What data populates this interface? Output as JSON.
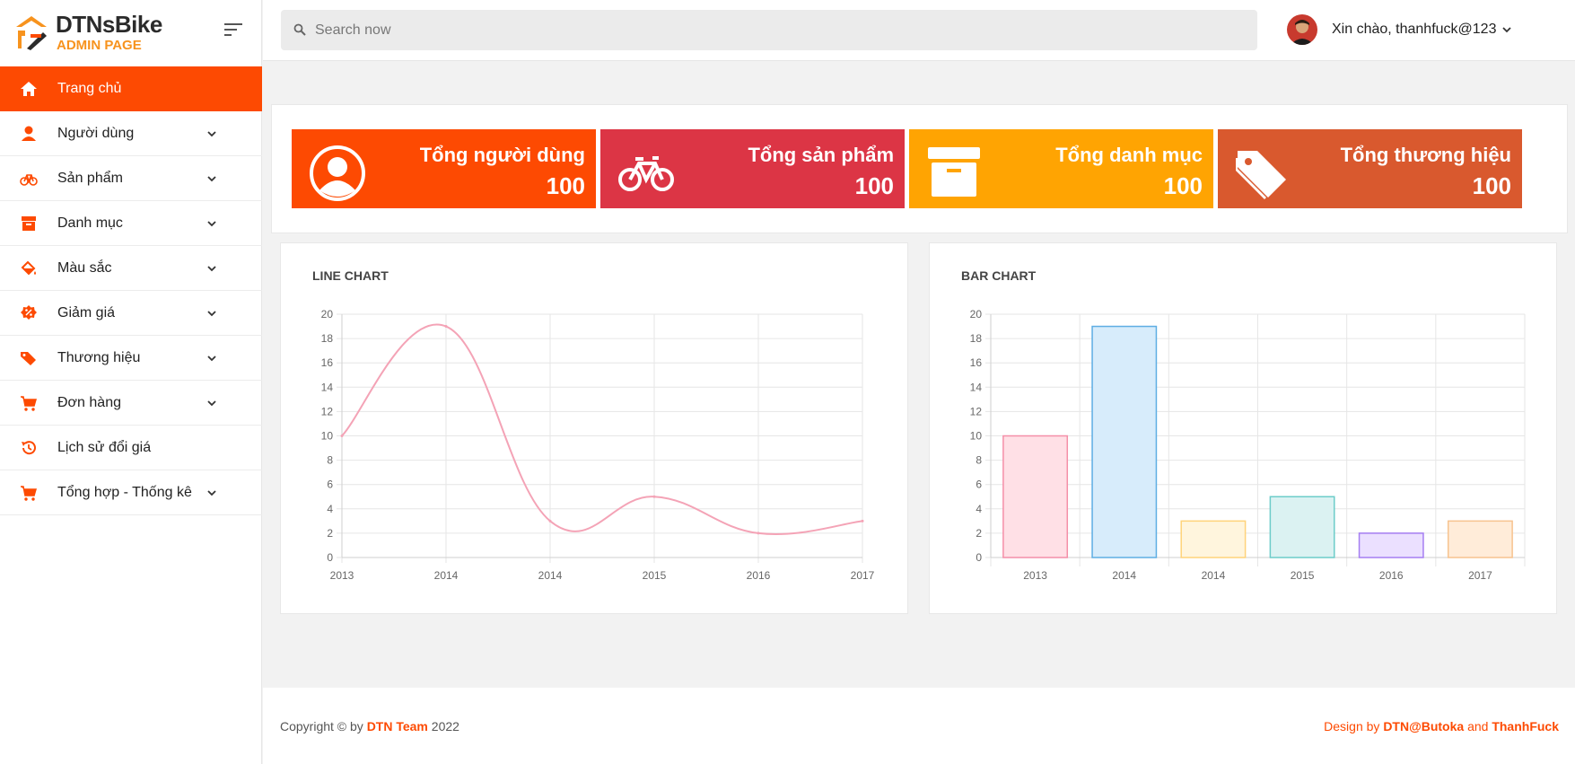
{
  "brand": {
    "name": "DTNsBike",
    "sub": "ADMIN PAGE"
  },
  "sidebar": {
    "items": [
      {
        "label": "Trang chủ",
        "icon": "home-icon",
        "active": true,
        "chevron": false
      },
      {
        "label": "Người dùng",
        "icon": "user-icon",
        "active": false,
        "chevron": true
      },
      {
        "label": "Sản phẩm",
        "icon": "bicycle-icon",
        "active": false,
        "chevron": true
      },
      {
        "label": "Danh mục",
        "icon": "archive-icon",
        "active": false,
        "chevron": true
      },
      {
        "label": "Màu sắc",
        "icon": "paint-bucket-icon",
        "active": false,
        "chevron": true
      },
      {
        "label": "Giảm giá",
        "icon": "discount-icon",
        "active": false,
        "chevron": true
      },
      {
        "label": "Thương hiệu",
        "icon": "tags-icon",
        "active": false,
        "chevron": true
      },
      {
        "label": "Đơn hàng",
        "icon": "cart-icon",
        "active": false,
        "chevron": true
      },
      {
        "label": "Lịch sử đổi giá",
        "icon": "history-icon",
        "active": false,
        "chevron": false
      },
      {
        "label": "Tổng hợp - Thống kê",
        "icon": "cart-icon",
        "active": false,
        "chevron": true
      }
    ]
  },
  "header": {
    "search_placeholder": "Search now",
    "greeting": "Xin chào, thanhfuck@123"
  },
  "stats": [
    {
      "title": "Tổng người dùng",
      "value": "100",
      "color": "#fd4a02",
      "icon": "user-circle-icon"
    },
    {
      "title": "Tổng sản phẩm",
      "value": "100",
      "color": "#dc3545",
      "icon": "bicycle-icon"
    },
    {
      "title": "Tổng danh mục",
      "value": "100",
      "color": "#ffa402",
      "icon": "archive-icon"
    },
    {
      "title": "Tổng thương hiệu",
      "value": "100",
      "color": "#d9592e",
      "icon": "tags-icon"
    }
  ],
  "chart_data": [
    {
      "type": "line",
      "title": "LINE CHART",
      "categories": [
        "2013",
        "2014",
        "2014",
        "2015",
        "2016",
        "2017"
      ],
      "values": [
        10,
        19,
        3,
        5,
        2,
        3
      ],
      "ylim": [
        0,
        20
      ],
      "yticks": [
        0,
        2,
        4,
        6,
        8,
        10,
        12,
        14,
        16,
        18,
        20
      ],
      "color": "#f4a3b6",
      "grid": true,
      "legend": "none"
    },
    {
      "type": "bar",
      "title": "BAR CHART",
      "categories": [
        "2013",
        "2014",
        "2014",
        "2015",
        "2016",
        "2017"
      ],
      "values": [
        10,
        19,
        3,
        5,
        2,
        3
      ],
      "ylim": [
        0,
        20
      ],
      "yticks": [
        0,
        2,
        4,
        6,
        8,
        10,
        12,
        14,
        16,
        18,
        20
      ],
      "fill_colors": [
        "#ffe0e6",
        "#d7ecfb",
        "#fff5dd",
        "#dbf2f2",
        "#ebe0ff",
        "#ffecd9"
      ],
      "border_colors": [
        "#f48fa8",
        "#5eaee3",
        "#ffd37a",
        "#6cccc9",
        "#a57ef2",
        "#f7c38f"
      ],
      "grid": true,
      "legend": "none"
    }
  ],
  "footer": {
    "prefix": "Copyright © by ",
    "team": "DTN Team",
    "year": " 2022",
    "design_prefix": "Design by ",
    "designer1": "DTN@Butoka",
    "and": " and ",
    "designer2": "ThanhFuck"
  }
}
